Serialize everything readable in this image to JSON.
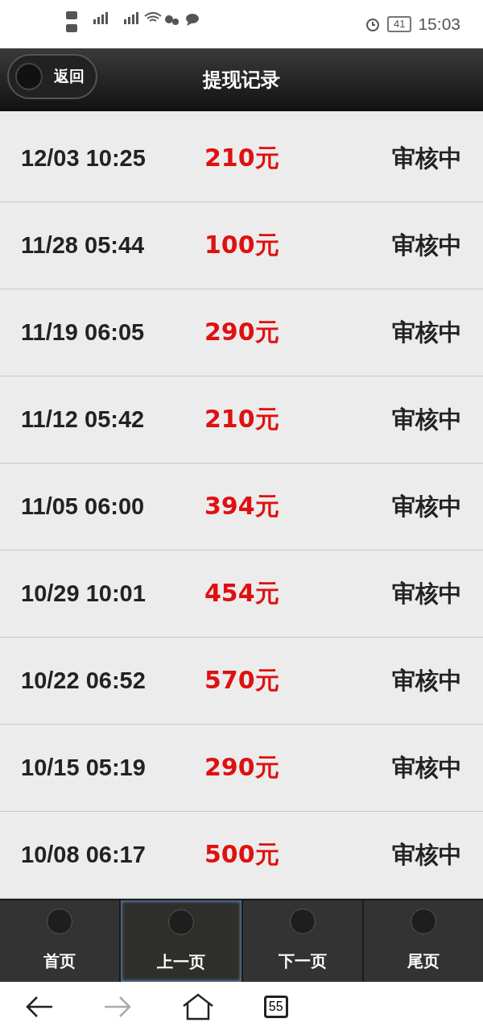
{
  "status_bar": {
    "battery": "41",
    "time": "15:03"
  },
  "header": {
    "back_button": "返回",
    "title": "提现记录"
  },
  "records": [
    {
      "time": "12/03 10:25",
      "amount": "210元",
      "status": "审核中"
    },
    {
      "time": "11/28 05:44",
      "amount": "100元",
      "status": "审核中"
    },
    {
      "time": "11/19 06:05",
      "amount": "290元",
      "status": "审核中"
    },
    {
      "time": "11/12 05:42",
      "amount": "210元",
      "status": "审核中"
    },
    {
      "time": "11/05 06:00",
      "amount": "394元",
      "status": "审核中"
    },
    {
      "time": "10/29 10:01",
      "amount": "454元",
      "status": "审核中"
    },
    {
      "time": "10/22 06:52",
      "amount": "570元",
      "status": "审核中"
    },
    {
      "time": "10/15 05:19",
      "amount": "290元",
      "status": "审核中"
    },
    {
      "time": "10/08 06:17",
      "amount": "500元",
      "status": "审核中"
    }
  ],
  "pager": [
    {
      "label": "首页",
      "selected": false
    },
    {
      "label": "上一页",
      "selected": true
    },
    {
      "label": "下一页",
      "selected": false
    },
    {
      "label": "尾页",
      "selected": false
    }
  ],
  "browser_bar": {
    "forward_disabled": true,
    "tab_count": "55"
  }
}
